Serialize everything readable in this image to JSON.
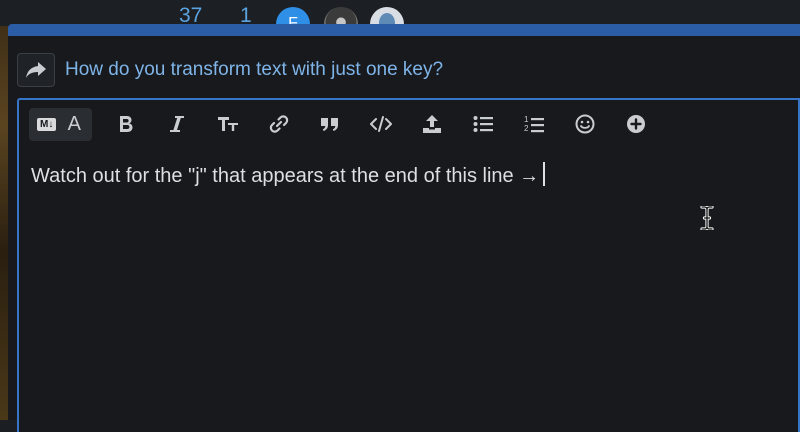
{
  "topbar": {
    "stats": [
      "37",
      "1"
    ],
    "avatar_initial": "F"
  },
  "composer": {
    "reply_title": "How do you transform text with just one key?",
    "body_text": "Watch out for the \"j\" that appears at the end of this line →",
    "toolbar": {
      "markdown_badge": "M↓",
      "rich_toggle_letter": "A",
      "buttons": [
        "bold",
        "italic",
        "heading",
        "link",
        "quote",
        "code",
        "upload",
        "bullet-list",
        "numbered-list",
        "emoji",
        "more"
      ]
    }
  },
  "colors": {
    "accent_blue": "#2a5da6",
    "link_blue": "#7fb4e8",
    "editor_border": "#3775c9"
  }
}
